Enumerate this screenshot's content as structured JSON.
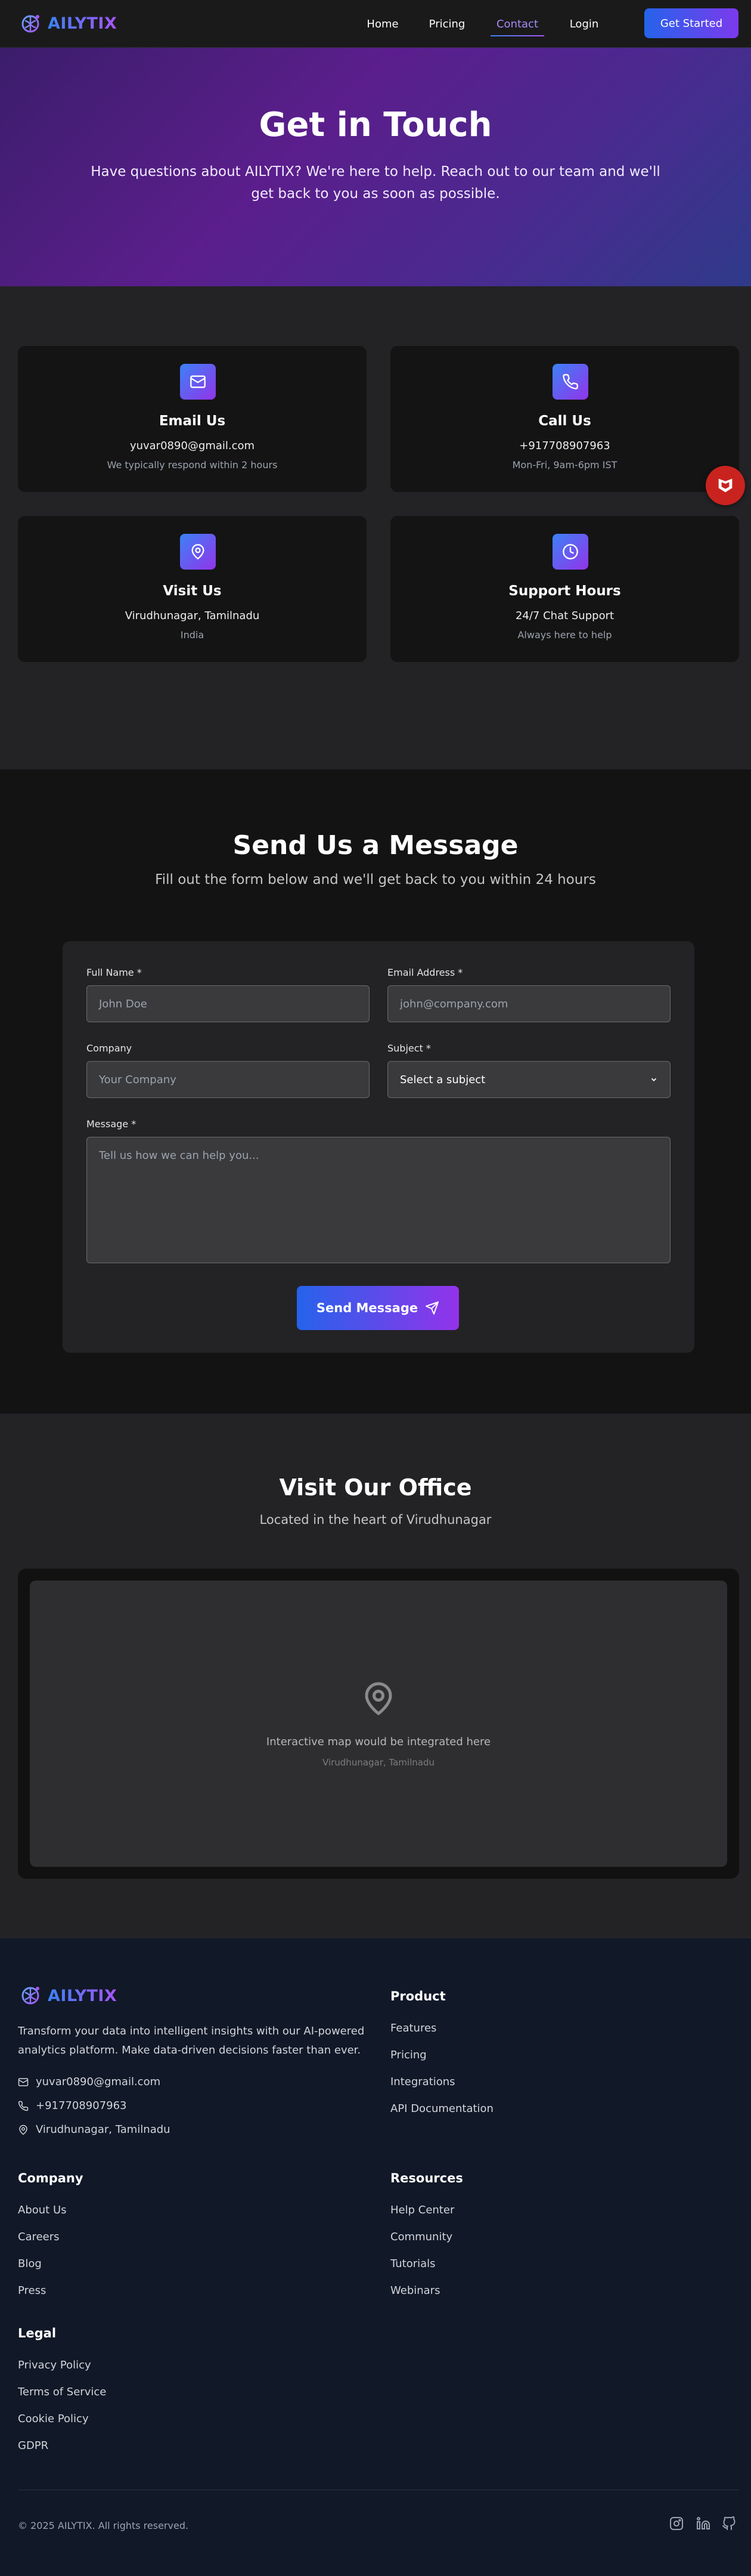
{
  "nav": {
    "brand": "AILYTIX",
    "links": [
      "Home",
      "Pricing",
      "Contact",
      "Login"
    ],
    "active": "Contact",
    "cta": "Get Started"
  },
  "hero": {
    "title": "Get in Touch",
    "subtitle": "Have questions about AILYTIX? We're here to help. Reach out to our team and we'll get back to you as soon as possible."
  },
  "contact_cards": [
    {
      "icon": "mail-icon",
      "title": "Email Us",
      "value": "yuvar0890@gmail.com",
      "sub": "We typically respond within 2 hours"
    },
    {
      "icon": "phone-icon",
      "title": "Call Us",
      "value": "+917708907963",
      "sub": "Mon-Fri, 9am-6pm IST"
    },
    {
      "icon": "map-pin-icon",
      "title": "Visit Us",
      "value": "Virudhunagar, Tamilnadu",
      "sub": "India"
    },
    {
      "icon": "clock-icon",
      "title": "Support Hours",
      "value": "24/7 Chat Support",
      "sub": "Always here to help"
    }
  ],
  "form": {
    "title": "Send Us a Message",
    "subtitle": "Fill out the form below and we'll get back to you within 24 hours",
    "full_name_label": "Full Name *",
    "full_name_placeholder": "John Doe",
    "email_label": "Email Address *",
    "email_placeholder": "john@company.com",
    "company_label": "Company",
    "company_placeholder": "Your Company",
    "subject_label": "Subject *",
    "subject_value": "Select a subject",
    "message_label": "Message *",
    "message_placeholder": "Tell us how we can help you...",
    "submit": "Send Message"
  },
  "office": {
    "title": "Visit Our Office",
    "subtitle": "Located in the heart of Virudhunagar",
    "map_text": "Interactive map would be integrated here",
    "map_location": "Virudhunagar, Tamilnadu"
  },
  "footer": {
    "brand": "AILYTIX",
    "description": "Transform your data into intelligent insights with our AI-powered analytics platform. Make data-driven decisions faster than ever.",
    "email": "yuvar0890@gmail.com",
    "phone": "+917708907963",
    "location": "Virudhunagar, Tamilnadu",
    "product": {
      "title": "Product",
      "items": [
        "Features",
        "Pricing",
        "Integrations",
        "API Documentation"
      ]
    },
    "company": {
      "title": "Company",
      "items": [
        "About Us",
        "Careers",
        "Blog",
        "Press"
      ]
    },
    "resources": {
      "title": "Resources",
      "items": [
        "Help Center",
        "Community",
        "Tutorials",
        "Webinars"
      ]
    },
    "legal": {
      "title": "Legal",
      "items": [
        "Privacy Policy",
        "Terms of Service",
        "Cookie Policy",
        "GDPR"
      ]
    },
    "copyright": "© 2025 AILYTIX. All rights reserved.",
    "social": [
      "instagram-icon",
      "linkedin-icon",
      "github-icon"
    ]
  },
  "colors": {
    "accent_start": "#2563eb",
    "accent_end": "#9333ea",
    "badge": "#c9231f"
  }
}
